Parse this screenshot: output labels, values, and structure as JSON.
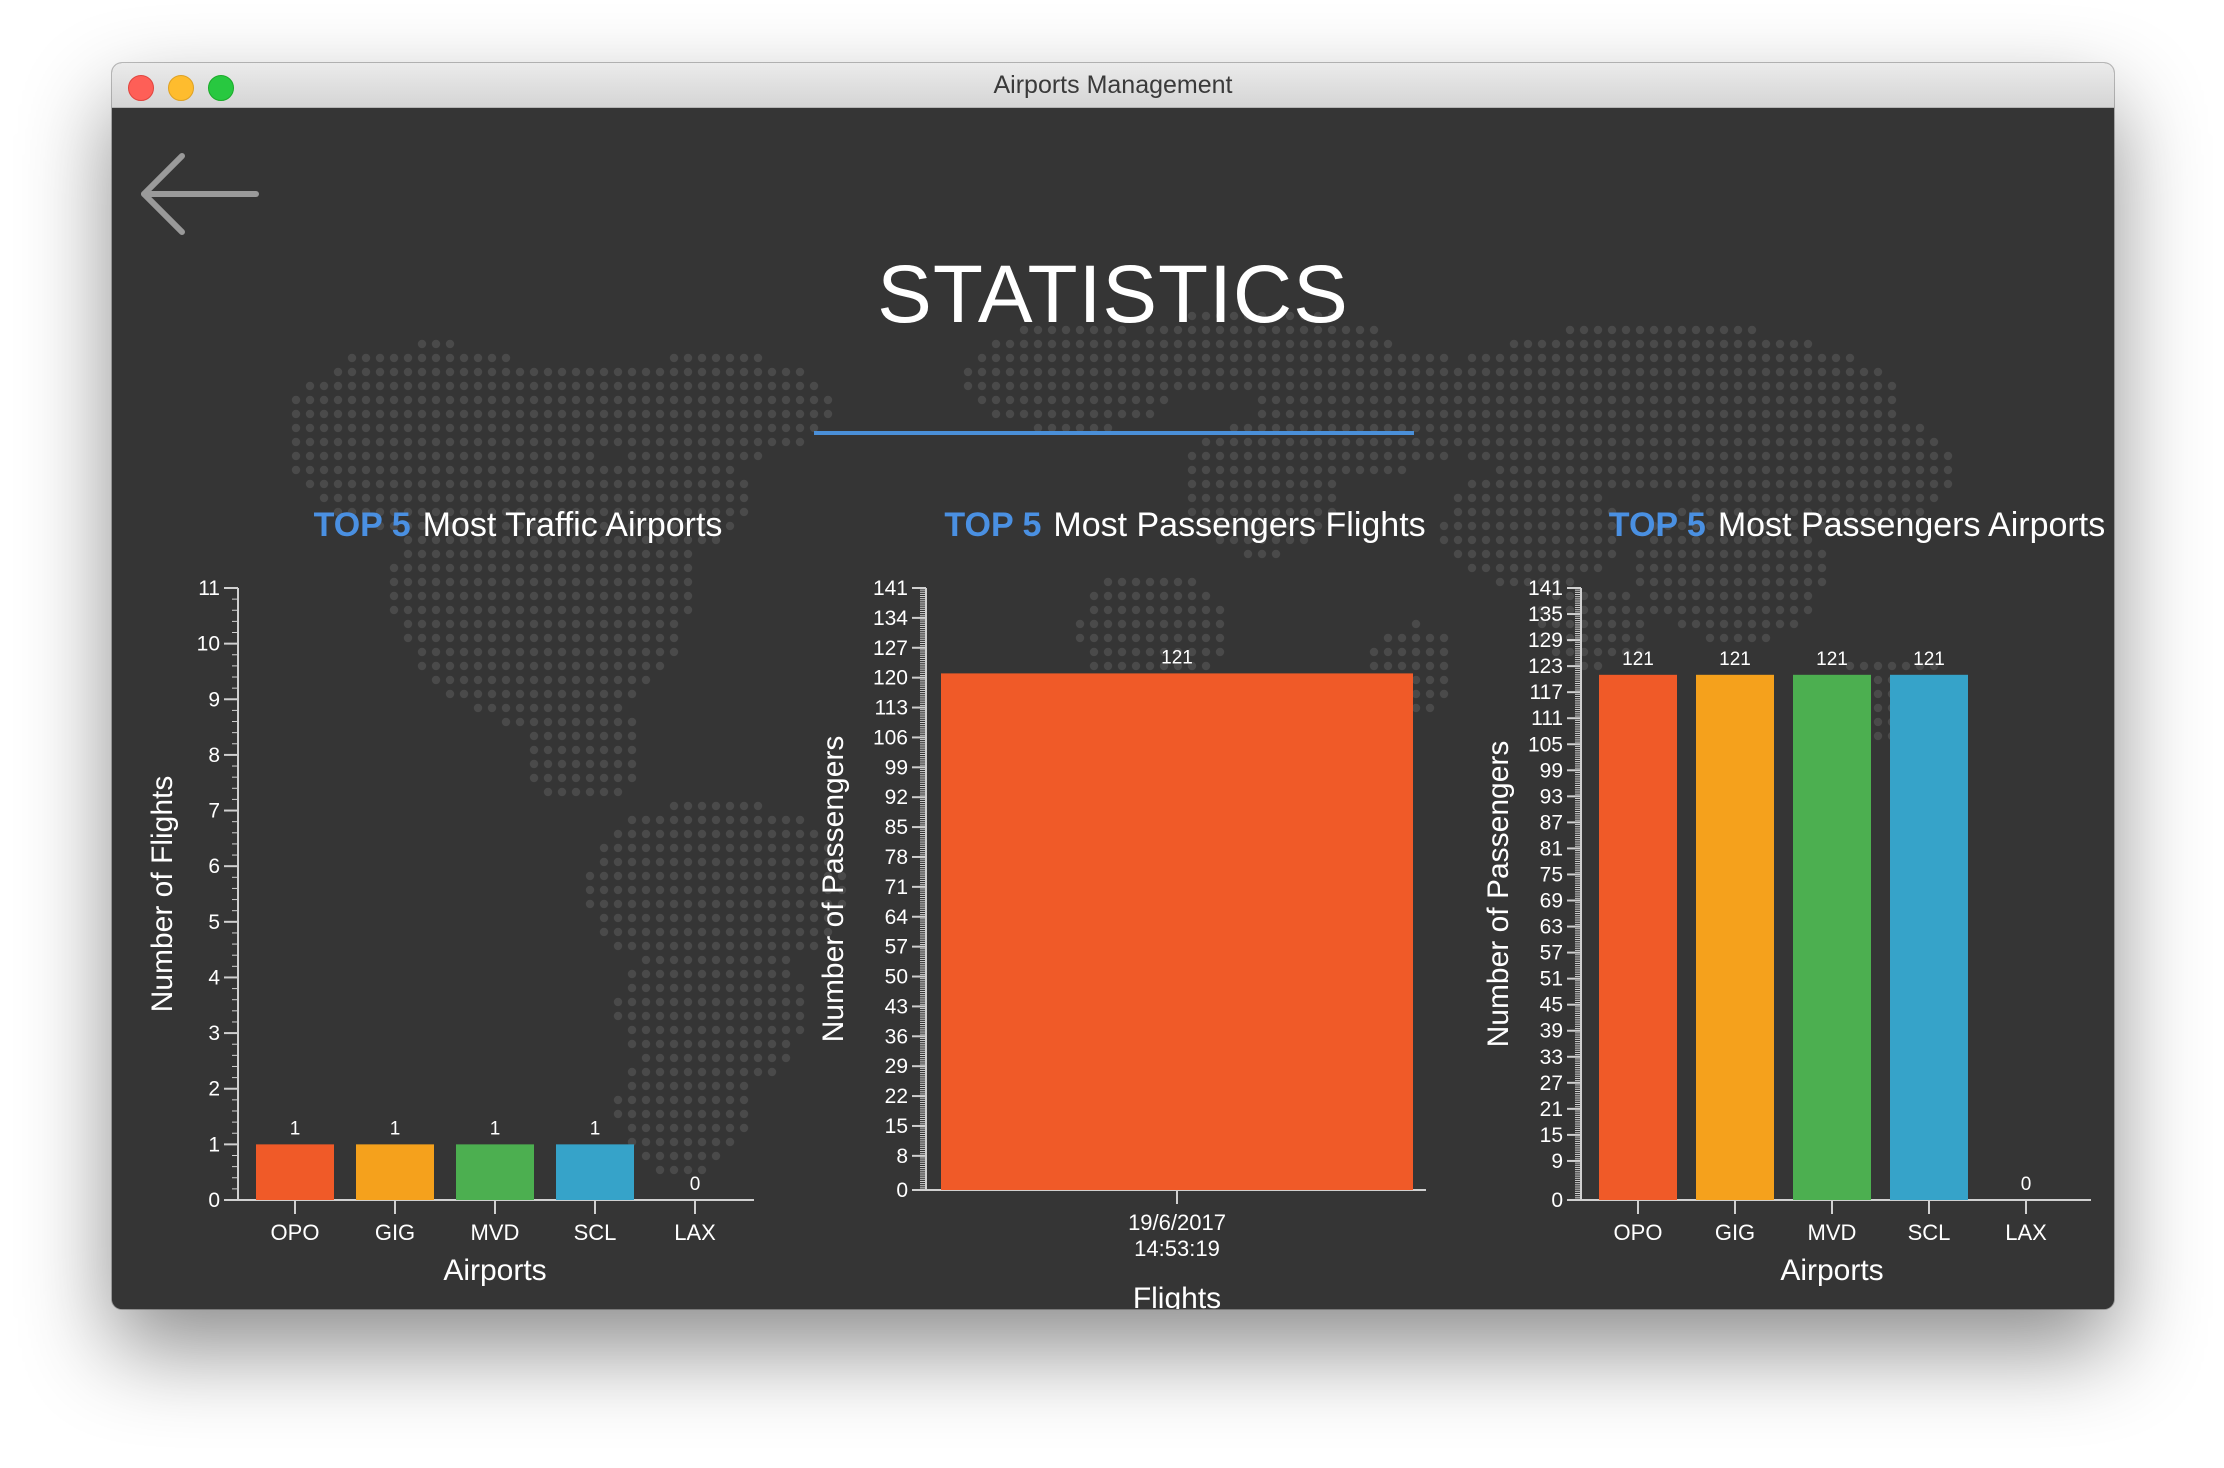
{
  "window": {
    "title": "Airports Management"
  },
  "page": {
    "title": "STATISTICS"
  },
  "colors": {
    "accent": "#4a90e2",
    "background": "#353535",
    "axis": "#d0d0d0",
    "text": "#ffffff",
    "bars": [
      "#f05a28",
      "#f5a11c",
      "#4caf50",
      "#36a3c9"
    ]
  },
  "icons": {
    "back": "left-arrow-icon"
  },
  "chart_data": [
    {
      "type": "bar",
      "highlight": "TOP 5",
      "title": "Most Traffic Airports",
      "categories": [
        "OPO",
        "GIG",
        "MVD",
        "SCL",
        "LAX"
      ],
      "values": [
        1,
        1,
        1,
        1,
        0
      ],
      "value_labels": [
        "1",
        "1",
        "1",
        "1",
        "0"
      ],
      "xlabel": "Airports",
      "ylabel": "Number of Flights",
      "ylim": [
        0,
        11
      ],
      "yticks": [
        0,
        1,
        2,
        3,
        4,
        5,
        6,
        7,
        8,
        9,
        10,
        11
      ],
      "grid": false
    },
    {
      "type": "bar",
      "highlight": "TOP 5",
      "title": "Most Passengers Flights",
      "categories": [
        "19/6/2017\n14:53:19"
      ],
      "values": [
        121
      ],
      "value_labels": [
        "121"
      ],
      "xlabel": "Flights",
      "ylabel": "Number of Passengers",
      "ylim": [
        0,
        141
      ],
      "yticks": [
        0,
        8,
        15,
        22,
        29,
        36,
        43,
        50,
        57,
        64,
        71,
        78,
        85,
        92,
        99,
        106,
        113,
        120,
        127,
        134,
        141
      ],
      "grid": false
    },
    {
      "type": "bar",
      "highlight": "TOP 5",
      "title": "Most Passengers Airports",
      "categories": [
        "OPO",
        "GIG",
        "MVD",
        "SCL",
        "LAX"
      ],
      "values": [
        121,
        121,
        121,
        121,
        0
      ],
      "value_labels": [
        "121",
        "121",
        "121",
        "121",
        "0"
      ],
      "xlabel": "Airports",
      "ylabel": "Number of Passengers",
      "ylim": [
        0,
        141
      ],
      "yticks": [
        0,
        9,
        15,
        21,
        27,
        33,
        39,
        45,
        51,
        57,
        63,
        69,
        75,
        81,
        87,
        93,
        99,
        105,
        111,
        117,
        123,
        129,
        135,
        141
      ],
      "grid": false
    }
  ]
}
